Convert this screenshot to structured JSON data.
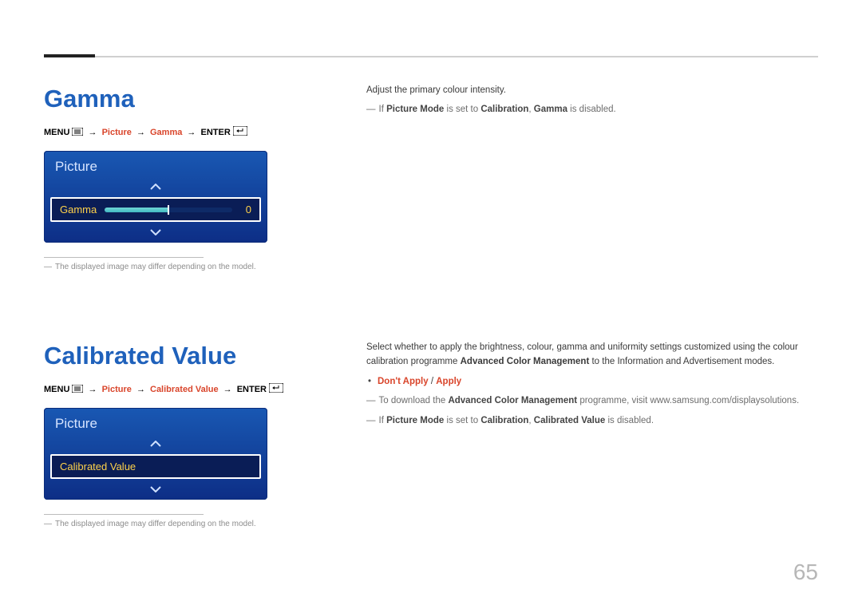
{
  "page_number": "65",
  "arrow": "→",
  "gamma": {
    "heading": "Gamma",
    "nav": {
      "menu": "MENU",
      "picture": "Picture",
      "item": "Gamma",
      "enter": "ENTER"
    },
    "osd": {
      "title": "Picture",
      "row_label": "Gamma",
      "value": "0"
    },
    "disclaimer": "The displayed image may differ depending on the model.",
    "right": {
      "intro": "Adjust the primary colour intensity.",
      "note_prefix": "If ",
      "note_pm": "Picture Mode",
      "note_mid": " is set to ",
      "note_cal": "Calibration",
      "note_sep": ", ",
      "note_gamma": "Gamma",
      "note_suffix": " is disabled."
    }
  },
  "calibrated": {
    "heading": "Calibrated Value",
    "nav": {
      "menu": "MENU",
      "picture": "Picture",
      "item": "Calibrated Value",
      "enter": "ENTER"
    },
    "osd": {
      "title": "Picture",
      "row_label": "Calibrated Value"
    },
    "disclaimer": "The displayed image may differ depending on the model.",
    "right": {
      "para_a": "Select whether to apply the brightness, colour, gamma and uniformity settings customized using the colour calibration programme ",
      "para_acm": "Advanced Color Management",
      "para_b": " to the Information and Advertisement modes.",
      "opt_dont": "Don't Apply",
      "opt_sep": " / ",
      "opt_apply": "Apply",
      "dl_a": "To download the ",
      "dl_acm": "Advanced Color Management",
      "dl_b": " programme, visit www.samsung.com/displaysolutions.",
      "note_prefix": "If ",
      "note_pm": "Picture Mode",
      "note_mid": " is set to ",
      "note_cal": "Calibration",
      "note_sep": ", ",
      "note_cv": "Calibrated Value",
      "note_suffix": " is disabled."
    }
  }
}
